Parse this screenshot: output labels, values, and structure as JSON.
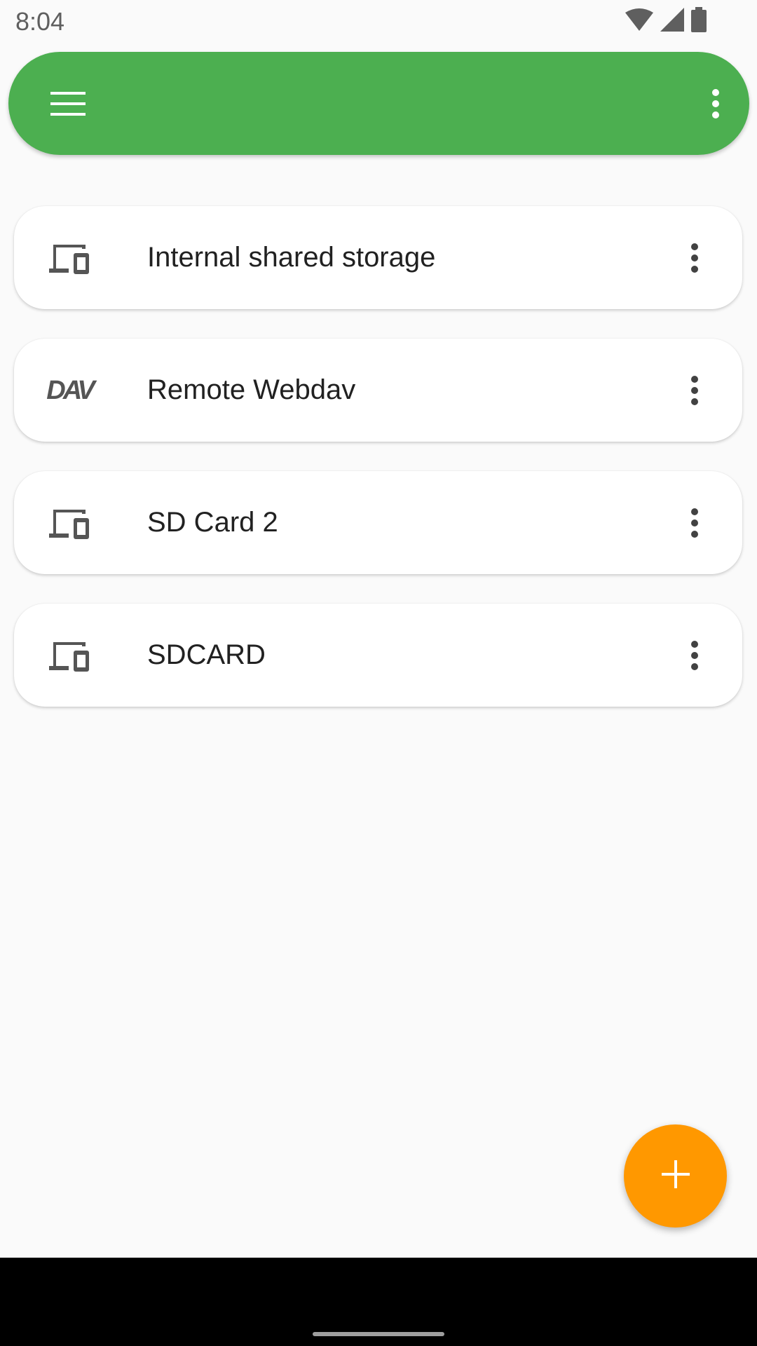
{
  "status_bar": {
    "time": "8:04",
    "icons": [
      "wifi-icon",
      "cellular-signal-icon",
      "battery-icon"
    ]
  },
  "toolbar": {
    "menu_icon": "hamburger-menu-icon",
    "overflow_icon": "more-vert-icon",
    "color": "#4caf50"
  },
  "storages": [
    {
      "label": "Internal shared storage",
      "icon": "devices-icon"
    },
    {
      "label": "Remote Webdav",
      "icon": "dav-icon",
      "icon_text": "DAV"
    },
    {
      "label": "SD Card 2",
      "icon": "devices-icon"
    },
    {
      "label": "SDCARD",
      "icon": "devices-icon"
    }
  ],
  "fab": {
    "icon": "plus-icon",
    "color": "#ff9800"
  }
}
